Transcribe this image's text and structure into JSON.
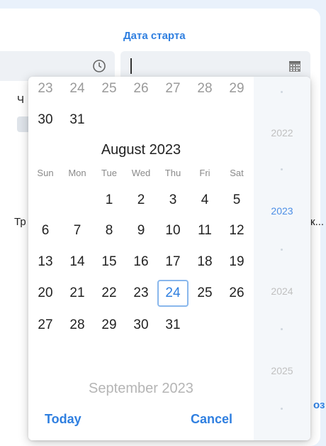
{
  "field": {
    "label": "Дата старта",
    "value": ""
  },
  "background": {
    "clipped_label_1": "Ч",
    "clipped_label_2": "Тр",
    "clipped_label_3": "к...",
    "clipped_label_4": "оз"
  },
  "picker": {
    "prev_tail": [
      "23",
      "24",
      "25",
      "26",
      "27",
      "28",
      "29",
      "30",
      "31"
    ],
    "month_title": "August 2023",
    "weekdays": [
      "Sun",
      "Mon",
      "Tue",
      "Wed",
      "Thu",
      "Fri",
      "Sat"
    ],
    "weeks": [
      [
        "",
        "",
        "1",
        "2",
        "3",
        "4",
        "5"
      ],
      [
        "6",
        "7",
        "8",
        "9",
        "10",
        "11",
        "12"
      ],
      [
        "13",
        "14",
        "15",
        "16",
        "17",
        "18",
        "19"
      ],
      [
        "20",
        "21",
        "22",
        "23",
        "24",
        "25",
        "26"
      ],
      [
        "27",
        "28",
        "29",
        "30",
        "31",
        "",
        ""
      ]
    ],
    "selected_day": "24",
    "next_month_title": "September 2023",
    "years": [
      "2022",
      "2023",
      "2024",
      "2025"
    ],
    "current_year": "2023",
    "today_label": "Today",
    "cancel_label": "Cancel"
  },
  "colors": {
    "accent": "#2f7fe0",
    "selected_border": "#89b7ec"
  }
}
